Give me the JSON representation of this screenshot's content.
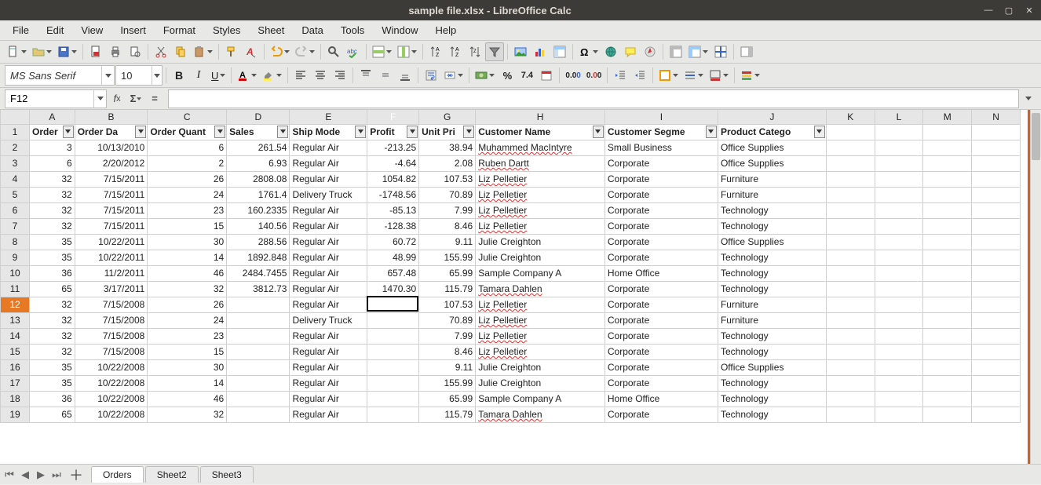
{
  "window": {
    "title": "sample file.xlsx - LibreOffice Calc"
  },
  "menubar": [
    "File",
    "Edit",
    "View",
    "Insert",
    "Format",
    "Styles",
    "Sheet",
    "Data",
    "Tools",
    "Window",
    "Help"
  ],
  "font": {
    "name": "MS Sans Serif",
    "size": "10"
  },
  "namebox": "F12",
  "columns": [
    "A",
    "B",
    "C",
    "D",
    "E",
    "F",
    "G",
    "H",
    "I",
    "J",
    "K",
    "L",
    "M",
    "N"
  ],
  "headers": [
    "Order",
    "Order Da",
    "Order Quant",
    "Sales",
    "Ship Mode",
    "Profit",
    "Unit Pri",
    "Customer Name",
    "Customer Segme",
    "Product Catego"
  ],
  "rows": [
    {
      "n": 2,
      "a": "3",
      "b": "10/13/2010",
      "c": "6",
      "d": "261.54",
      "e": "Regular Air",
      "f": "-213.25",
      "g": "38.94",
      "h": "Muhammed MacIntyre",
      "i": "Small Business",
      "j": "Office Supplies",
      "sq": true
    },
    {
      "n": 3,
      "a": "6",
      "b": "2/20/2012",
      "c": "2",
      "d": "6.93",
      "e": "Regular Air",
      "f": "-4.64",
      "g": "2.08",
      "h": "Ruben Dartt",
      "i": "Corporate",
      "j": "Office Supplies",
      "sq": true
    },
    {
      "n": 4,
      "a": "32",
      "b": "7/15/2011",
      "c": "26",
      "d": "2808.08",
      "e": "Regular Air",
      "f": "1054.82",
      "g": "107.53",
      "h": "Liz Pelletier",
      "i": "Corporate",
      "j": "Furniture",
      "sq": true
    },
    {
      "n": 5,
      "a": "32",
      "b": "7/15/2011",
      "c": "24",
      "d": "1761.4",
      "e": "Delivery Truck",
      "f": "-1748.56",
      "g": "70.89",
      "h": "Liz Pelletier",
      "i": "Corporate",
      "j": "Furniture",
      "sq": true
    },
    {
      "n": 6,
      "a": "32",
      "b": "7/15/2011",
      "c": "23",
      "d": "160.2335",
      "e": "Regular Air",
      "f": "-85.13",
      "g": "7.99",
      "h": "Liz Pelletier",
      "i": "Corporate",
      "j": "Technology",
      "sq": true
    },
    {
      "n": 7,
      "a": "32",
      "b": "7/15/2011",
      "c": "15",
      "d": "140.56",
      "e": "Regular Air",
      "f": "-128.38",
      "g": "8.46",
      "h": "Liz Pelletier",
      "i": "Corporate",
      "j": "Technology",
      "sq": true
    },
    {
      "n": 8,
      "a": "35",
      "b": "10/22/2011",
      "c": "30",
      "d": "288.56",
      "e": "Regular Air",
      "f": "60.72",
      "g": "9.11",
      "h": "Julie Creighton",
      "i": "Corporate",
      "j": "Office Supplies"
    },
    {
      "n": 9,
      "a": "35",
      "b": "10/22/2011",
      "c": "14",
      "d": "1892.848",
      "e": "Regular Air",
      "f": "48.99",
      "g": "155.99",
      "h": "Julie Creighton",
      "i": "Corporate",
      "j": "Technology"
    },
    {
      "n": 10,
      "a": "36",
      "b": "11/2/2011",
      "c": "46",
      "d": "2484.7455",
      "e": "Regular Air",
      "f": "657.48",
      "g": "65.99",
      "h": "Sample Company A",
      "i": "Home Office",
      "j": "Technology"
    },
    {
      "n": 11,
      "a": "65",
      "b": "3/17/2011",
      "c": "32",
      "d": "3812.73",
      "e": "Regular Air",
      "f": "1470.30",
      "g": "115.79",
      "h": "Tamara Dahlen",
      "i": "Corporate",
      "j": "Technology",
      "sq": true
    },
    {
      "n": 12,
      "a": "32",
      "b": "7/15/2008",
      "c": "26",
      "d": "",
      "e": "Regular Air",
      "f": "",
      "g": "107.53",
      "h": "Liz Pelletier",
      "i": "Corporate",
      "j": "Furniture",
      "sq": true,
      "sel": true
    },
    {
      "n": 13,
      "a": "32",
      "b": "7/15/2008",
      "c": "24",
      "d": "",
      "e": "Delivery Truck",
      "f": "",
      "g": "70.89",
      "h": "Liz Pelletier",
      "i": "Corporate",
      "j": "Furniture",
      "sq": true
    },
    {
      "n": 14,
      "a": "32",
      "b": "7/15/2008",
      "c": "23",
      "d": "",
      "e": "Regular Air",
      "f": "",
      "g": "7.99",
      "h": "Liz Pelletier",
      "i": "Corporate",
      "j": "Technology",
      "sq": true
    },
    {
      "n": 15,
      "a": "32",
      "b": "7/15/2008",
      "c": "15",
      "d": "",
      "e": "Regular Air",
      "f": "",
      "g": "8.46",
      "h": "Liz Pelletier",
      "i": "Corporate",
      "j": "Technology",
      "sq": true
    },
    {
      "n": 16,
      "a": "35",
      "b": "10/22/2008",
      "c": "30",
      "d": "",
      "e": "Regular Air",
      "f": "",
      "g": "9.11",
      "h": "Julie Creighton",
      "i": "Corporate",
      "j": "Office Supplies"
    },
    {
      "n": 17,
      "a": "35",
      "b": "10/22/2008",
      "c": "14",
      "d": "",
      "e": "Regular Air",
      "f": "",
      "g": "155.99",
      "h": "Julie Creighton",
      "i": "Corporate",
      "j": "Technology"
    },
    {
      "n": 18,
      "a": "36",
      "b": "10/22/2008",
      "c": "46",
      "d": "",
      "e": "Regular Air",
      "f": "",
      "g": "65.99",
      "h": "Sample Company A",
      "i": "Home Office",
      "j": "Technology"
    },
    {
      "n": 19,
      "a": "65",
      "b": "10/22/2008",
      "c": "32",
      "d": "",
      "e": "Regular Air",
      "f": "",
      "g": "115.79",
      "h": "Tamara Dahlen",
      "i": "Corporate",
      "j": "Technology",
      "sq": true
    }
  ],
  "tabs": [
    "Orders",
    "Sheet2",
    "Sheet3"
  ],
  "active_tab": 0,
  "active_cell": "F12",
  "active_col": "F"
}
